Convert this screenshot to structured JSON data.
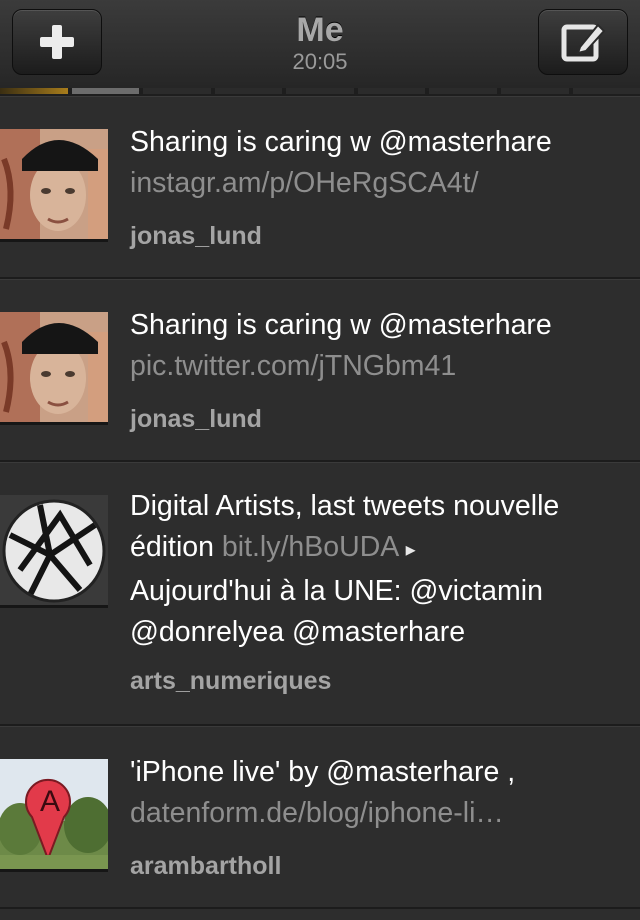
{
  "navbar": {
    "title": "Me",
    "time": "20:05",
    "add_icon": "plus-icon",
    "compose_icon": "compose-icon"
  },
  "page_indicator": {
    "count": 9,
    "active_index": 1
  },
  "tweets": [
    {
      "text": "Sharing is caring w @masterhare",
      "link": "instagr.am/p/OHeRgSCA4t/",
      "author": "jonas_lund",
      "avatar": "jonas-lund-avatar"
    },
    {
      "text": "Sharing is caring w @masterhare",
      "link": "pic.twitter.com/jTNGbm41",
      "author": "jonas_lund",
      "avatar": "jonas-lund-avatar"
    },
    {
      "text_line1": "Digital Artists, last tweets nouvelle",
      "text_line2_prefix": "édition ",
      "link": "bit.ly/hBoUDA",
      "arrow": "▸",
      "text_line3": "Aujourd'hui à la UNE: @victamin",
      "text_line4": "@donrelyea @masterhare",
      "author": "arts_numeriques",
      "avatar": "arts-numeriques-avatar"
    },
    {
      "text": "'iPhone live' by @masterhare ,",
      "link": "datenform.de/blog/iphone-li…",
      "author": "arambartholl",
      "avatar": "arambartholl-avatar"
    }
  ],
  "colors": {
    "background": "#2d2d2d",
    "text": "#ffffff",
    "link": "#8e8e8e",
    "author": "#a4a4a4"
  }
}
